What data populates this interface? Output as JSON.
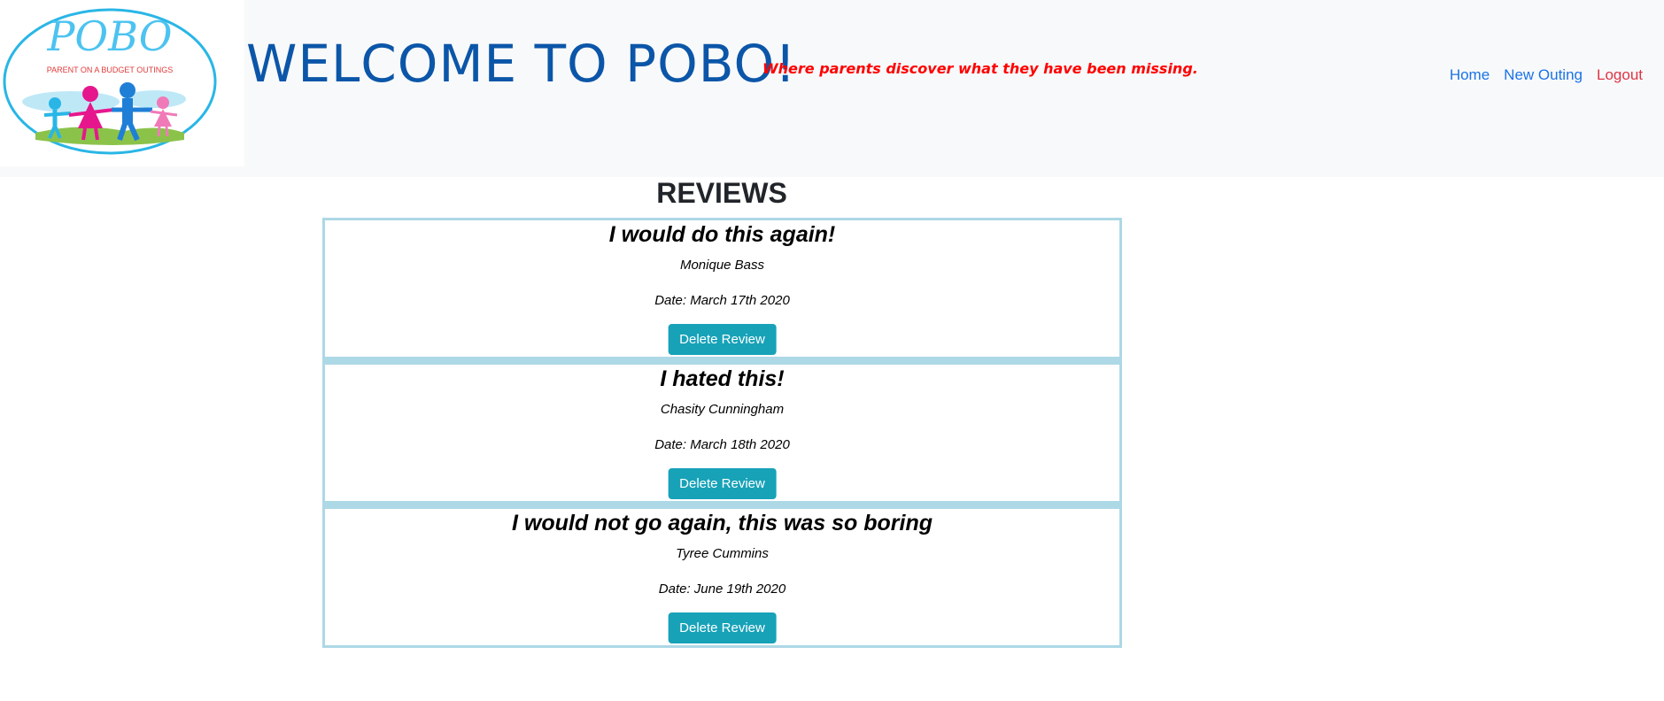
{
  "header": {
    "logo_text": "POBO",
    "logo_subtext": "PARENT ON A BUDGET OUTINGS",
    "welcome": "WELCOME TO POBO!",
    "tagline": "Where parents discover what they have been missing."
  },
  "nav": {
    "home": "Home",
    "new_outing": "New Outing",
    "logout": "Logout"
  },
  "main": {
    "title": "REVIEWS",
    "reviews": [
      {
        "title": "I would do this again!",
        "author": "Monique Bass",
        "date": "Date: March 17th 2020",
        "button": "Delete Review"
      },
      {
        "title": "I hated this!",
        "author": "Chasity Cunningham",
        "date": "Date: March 18th 2020",
        "button": "Delete Review"
      },
      {
        "title": "I would not go again, this was so boring",
        "author": "Tyree Cummins",
        "date": "Date: June 19th 2020",
        "button": "Delete Review"
      }
    ]
  },
  "colors": {
    "header_bg": "#f8f9fa",
    "welcome": "#0b56a8",
    "tagline": "#ff0000",
    "nav_link": "#1a73e8",
    "logout": "#dc3545",
    "card_border": "#add8e6",
    "button": "#17a2b8"
  }
}
